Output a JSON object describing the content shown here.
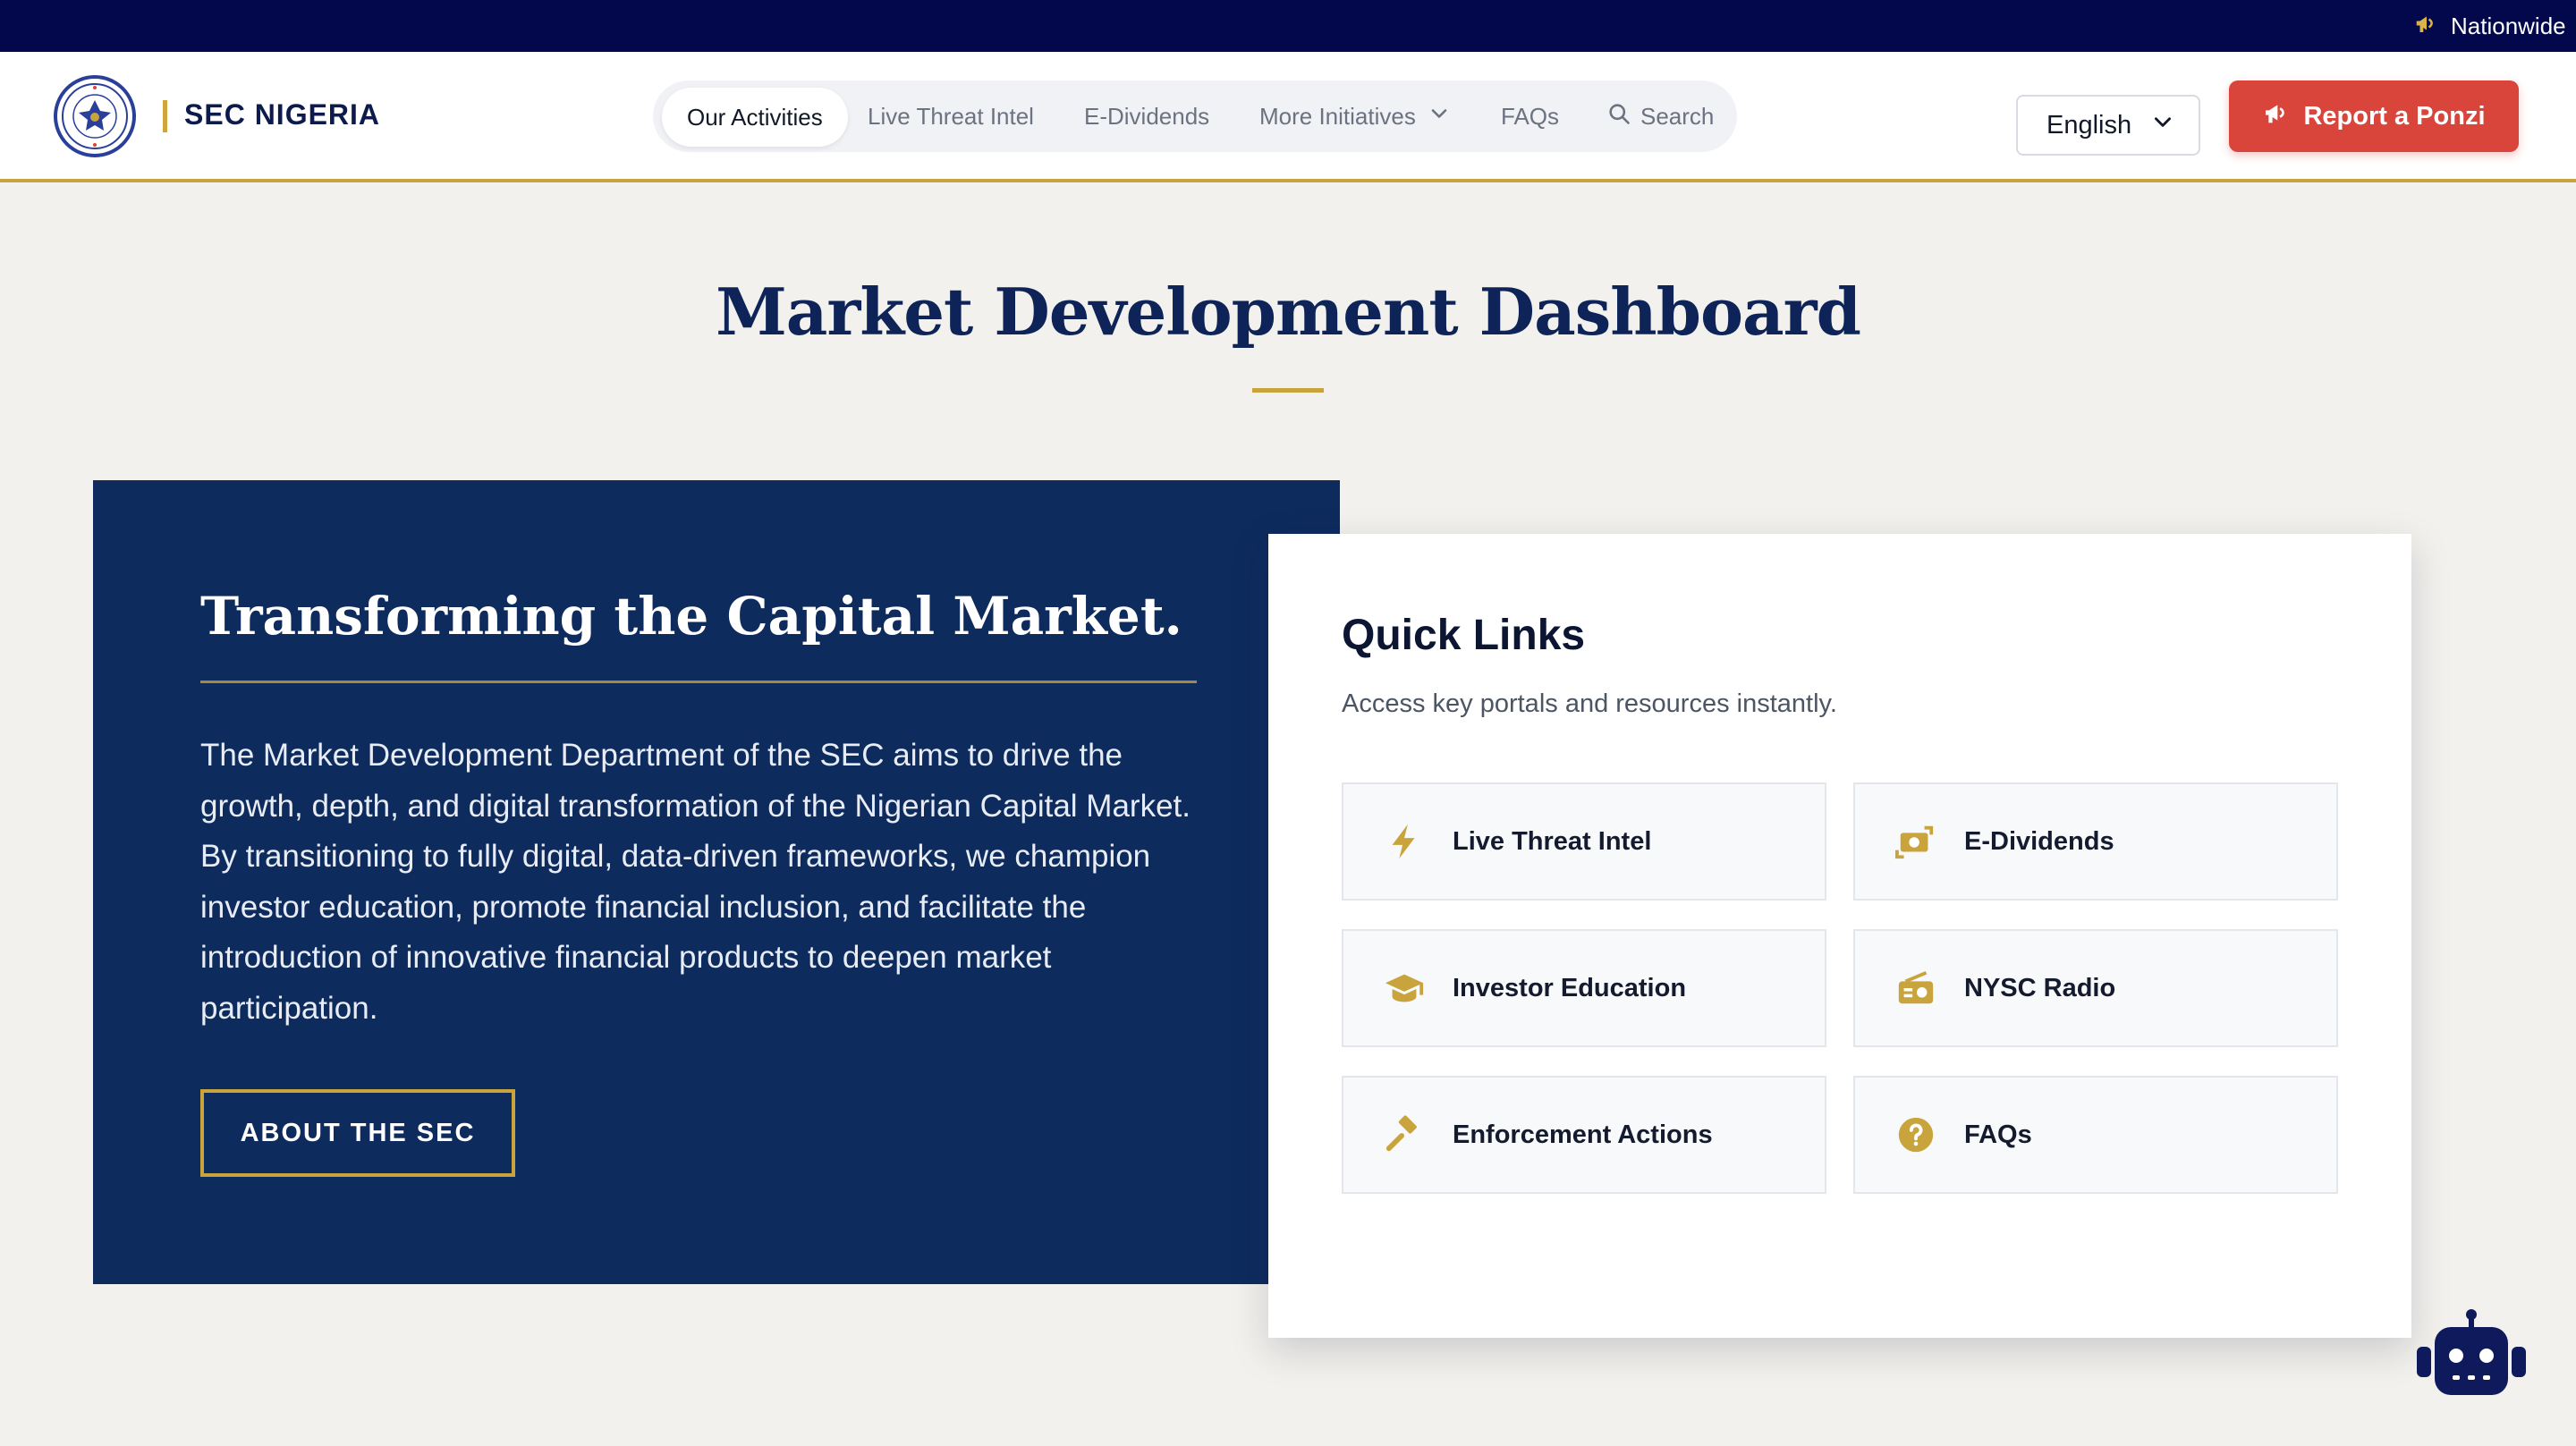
{
  "colors": {
    "navy": "#0e2b5e",
    "gold": "#c9a43c",
    "report_red": "#d9443b",
    "topbar": "#02084b",
    "page_bg": "#f3f1ed"
  },
  "top_bar": {
    "ticker_icon": "megaphone-icon",
    "ticker_text": "Nationwide"
  },
  "header": {
    "logo": "sec-seal-logo",
    "brand": "SEC NIGERIA",
    "nav": [
      {
        "label": "Our Activities",
        "active": true
      },
      {
        "label": "Live Threat Intel"
      },
      {
        "label": "E-Dividends"
      },
      {
        "label": "More Initiatives",
        "icon": "chevron-down-icon"
      },
      {
        "label": "FAQs"
      },
      {
        "label": "Search",
        "icon": "search-icon"
      }
    ],
    "language": "English",
    "report_button": "Report a Ponzi"
  },
  "main": {
    "title": "Market Development Dashboard",
    "hero": {
      "heading": "Transforming the Capital Market.",
      "body": "The Market Development Department of the SEC aims to drive the growth, depth, and digital transformation of the Nigerian Capital Market. By transitioning to fully digital, data-driven frameworks, we champion investor education, promote financial inclusion, and facilitate the introduction of innovative financial products to deepen market participation.",
      "button": "ABOUT THE SEC"
    },
    "quick_links": {
      "title": "Quick Links",
      "subtitle": "Access key portals and resources instantly.",
      "items": [
        {
          "label": "Live Threat Intel",
          "icon": "lightning-bolt-icon"
        },
        {
          "label": "E-Dividends",
          "icon": "money-transfer-icon"
        },
        {
          "label": "Investor Education",
          "icon": "graduation-cap-icon"
        },
        {
          "label": "NYSC Radio",
          "icon": "radio-icon"
        },
        {
          "label": "Enforcement Actions",
          "icon": "gavel-icon"
        },
        {
          "label": "FAQs",
          "icon": "question-circle-icon"
        }
      ]
    }
  },
  "chat_widget": {
    "icon": "robot-icon"
  }
}
